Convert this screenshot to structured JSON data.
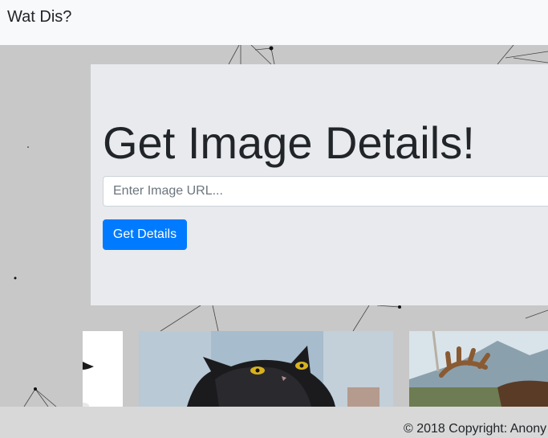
{
  "navbar": {
    "brand": "Wat Dis?"
  },
  "hero": {
    "title": "Get Image Details!",
    "url_input": {
      "placeholder": "Enter Image URL...",
      "value": ""
    },
    "submit_label": "Get Details"
  },
  "gallery": {
    "images": [
      {
        "subject": "bird"
      },
      {
        "subject": "black cat"
      },
      {
        "subject": "moose"
      }
    ]
  },
  "footer": {
    "copyright": "© 2018 Copyright: Anony"
  },
  "colors": {
    "primary": "#007bff",
    "navbar_bg": "#f8f9fa",
    "page_bg": "#c8c8c8",
    "hero_bg": "#e8eaed",
    "footer_bg": "#d8d8d8"
  }
}
